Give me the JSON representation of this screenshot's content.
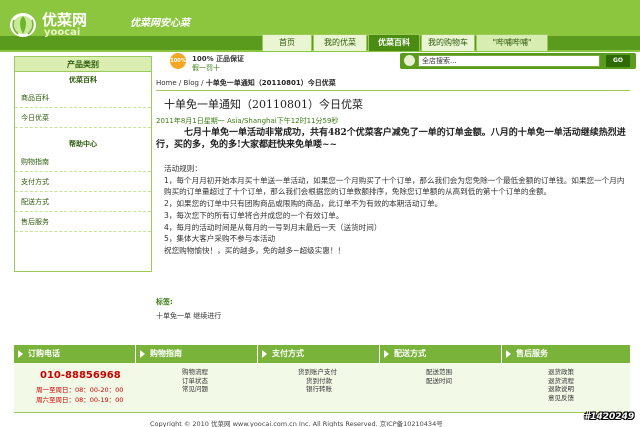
{
  "header": {
    "logo_cn": "优菜网",
    "logo_en": "yoocai",
    "slogan": "优菜网安心菜",
    "nav": [
      {
        "label": "首页"
      },
      {
        "label": "我的优菜"
      },
      {
        "label": "优菜百科"
      },
      {
        "label": "我的购物车"
      },
      {
        "label": "\"哔哺哔哺\""
      }
    ]
  },
  "promo": {
    "badge": "100%",
    "line1": "100% 正品保证",
    "line2": "假一罚十"
  },
  "search": {
    "placeholder": "全店搜索...",
    "button": "GO"
  },
  "sidebar": {
    "title": "产品类别",
    "section1": "优菜百科",
    "items1": [
      "商品百科",
      "今日优菜"
    ],
    "section2": "帮助中心",
    "items2": [
      "购物指南",
      "支付方式",
      "配送方式",
      "售后服务"
    ]
  },
  "breadcrumb": {
    "prefix": "Home / Blog /",
    "current": "十单免一单通知（20110801）今日优菜"
  },
  "post": {
    "title": "十单免一单通知（20110801）今日优菜",
    "date": "2011年8月1日星期一 Asia/Shanghai下午12时11分59秒",
    "lead": "七月十单免一单活动非常成功，共有482个优菜客户减免了一单的订单金额。八月的十单免一单活动继续热烈进行，买的多，免的多!大家都赶快来免单喽~~",
    "rules_title": "活动规则：",
    "rule1": "1，每个月月初开始本月买十单送一单活动，如果您一个月购买了十个订单，那么我们会为您免除一个最低金额的订单钱。如果您一个月内购买的订单量超过了十个订单，那么我们会根据您的订单数额排序，免除您订单额的从高到低的第十个订单的金额。",
    "rule2": "2，如果您的订单中只有团购商品或限购的商品，此订单不为有效的本期活动订单。",
    "rule3": "3，每次您下的所有订单将合并成您的一个有效订单。",
    "rule4": "4，每月的活动时间是从每月的一号到月末最后一天（送货时间）",
    "rule5": "5，集体大客户采购不参与本活动",
    "closing": "祝您购物愉快！，买的越多，免的越多~超级实惠！！",
    "tags_label": "标签:",
    "tags_value": "十单免一单 继续进行"
  },
  "footer": {
    "cols": [
      "订购电话",
      "购物指南",
      "支付方式",
      "配送方式",
      "售后服务"
    ],
    "hotline": "010-88856968",
    "hours1": "周一至周日：08：00-20：00",
    "hours2": "周六至周日：08：00-19：00",
    "guide": [
      "购物流程",
      "订单状态",
      "常见问题"
    ],
    "payment": [
      "货到账户支付",
      "货到付款",
      "银行转账"
    ],
    "delivery": [
      "配送范围",
      "配送时间"
    ],
    "after_sales": [
      "退货政策",
      "退货流程",
      "退款说明",
      "意见反馈"
    ],
    "copyright": "Copyright © 2010 优菜网 www.yoocai.com.cn Inc. All Rights Reserved. 京ICP备10210434号",
    "watermark": "#1420249"
  }
}
